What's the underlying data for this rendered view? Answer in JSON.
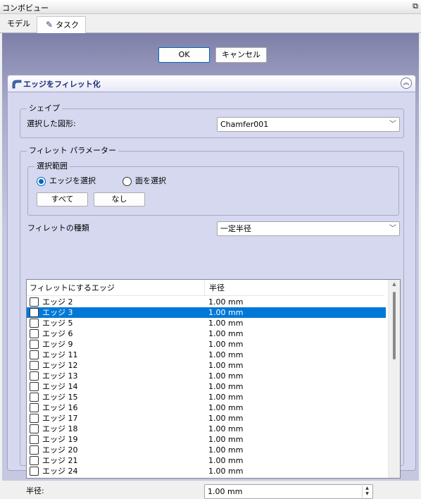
{
  "window": {
    "title": "コンボビュー",
    "float_icon": "undock-icon"
  },
  "tabs": [
    {
      "label": "モデル"
    },
    {
      "label": "タスク",
      "icon": "pencil-icon"
    }
  ],
  "dialog": {
    "ok_label": "OK",
    "cancel_label": "キャンセル"
  },
  "panel": {
    "title": "エッジをフィレット化",
    "shape_group": {
      "title": "シェイプ",
      "selected_label": "選択した図形:",
      "selected_value": "Chamfer001"
    },
    "params_group": {
      "title": "フィレット パラメーター",
      "selection_group": {
        "title": "選択範囲",
        "radio_edges": "エッジを選択",
        "radio_faces": "面を選択",
        "all_label": "すべて",
        "none_label": "なし"
      },
      "type_label": "フィレットの種類",
      "type_value": "一定半径",
      "table": {
        "headers": [
          "フィレットにするエッジ",
          "半径"
        ],
        "rows": [
          {
            "name": "エッジ 2",
            "value": "1.00 mm"
          },
          {
            "name": "エッジ 3",
            "value": "1.00 mm"
          },
          {
            "name": "エッジ 5",
            "value": "1.00 mm"
          },
          {
            "name": "エッジ 6",
            "value": "1.00 mm"
          },
          {
            "name": "エッジ 9",
            "value": "1.00 mm"
          },
          {
            "name": "エッジ 11",
            "value": "1.00 mm"
          },
          {
            "name": "エッジ 12",
            "value": "1.00 mm"
          },
          {
            "name": "エッジ 13",
            "value": "1.00 mm"
          },
          {
            "name": "エッジ 14",
            "value": "1.00 mm"
          },
          {
            "name": "エッジ 15",
            "value": "1.00 mm"
          },
          {
            "name": "エッジ 16",
            "value": "1.00 mm"
          },
          {
            "name": "エッジ 17",
            "value": "1.00 mm"
          },
          {
            "name": "エッジ 18",
            "value": "1.00 mm"
          },
          {
            "name": "エッジ 19",
            "value": "1.00 mm"
          },
          {
            "name": "エッジ 20",
            "value": "1.00 mm"
          },
          {
            "name": "エッジ 21",
            "value": "1.00 mm"
          },
          {
            "name": "エッジ 24",
            "value": "1.00 mm"
          }
        ]
      },
      "radius_label": "半径:",
      "radius_value": "1.00 mm"
    }
  },
  "colors": {
    "selection": "#0078d7",
    "header_text": "#1b2f73",
    "panel_top": "#7d7fa8",
    "panel_box": "#d6d8f0"
  }
}
